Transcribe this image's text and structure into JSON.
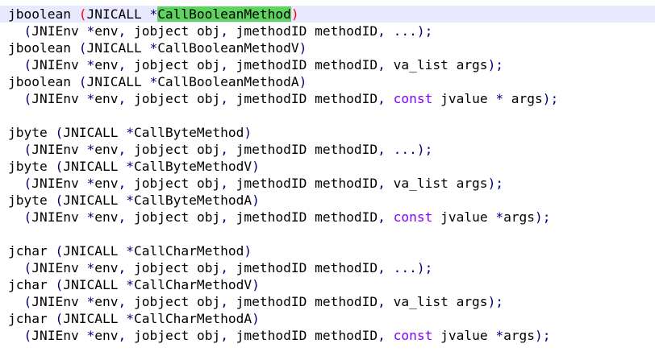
{
  "editor": {
    "lines": [
      {
        "parts": [
          {
            "t": "jboolean ",
            "c": "plain"
          },
          {
            "t": "(",
            "c": "paren-red"
          },
          {
            "t": "JNICALL ",
            "c": "plain"
          },
          {
            "t": "*",
            "c": "sym"
          },
          {
            "t": "CallBooleanMethod",
            "c": "hl"
          },
          {
            "t": ")",
            "c": "paren-red"
          }
        ]
      },
      {
        "parts": [
          {
            "t": "  ",
            "c": "plain"
          },
          {
            "t": "(",
            "c": "sym"
          },
          {
            "t": "JNIEnv ",
            "c": "plain"
          },
          {
            "t": "*",
            "c": "sym"
          },
          {
            "t": "env",
            "c": "plain"
          },
          {
            "t": ",",
            "c": "sym"
          },
          {
            "t": " jobject obj",
            "c": "plain"
          },
          {
            "t": ",",
            "c": "sym"
          },
          {
            "t": " jmethodID methodID",
            "c": "plain"
          },
          {
            "t": ",",
            "c": "sym"
          },
          {
            "t": " ",
            "c": "plain"
          },
          {
            "t": "...);",
            "c": "sym"
          }
        ]
      },
      {
        "parts": [
          {
            "t": "jboolean ",
            "c": "plain"
          },
          {
            "t": "(",
            "c": "sym"
          },
          {
            "t": "JNICALL ",
            "c": "plain"
          },
          {
            "t": "*",
            "c": "sym"
          },
          {
            "t": "CallBooleanMethodV",
            "c": "plain"
          },
          {
            "t": ")",
            "c": "sym"
          }
        ]
      },
      {
        "parts": [
          {
            "t": "  ",
            "c": "plain"
          },
          {
            "t": "(",
            "c": "sym"
          },
          {
            "t": "JNIEnv ",
            "c": "plain"
          },
          {
            "t": "*",
            "c": "sym"
          },
          {
            "t": "env",
            "c": "plain"
          },
          {
            "t": ",",
            "c": "sym"
          },
          {
            "t": " jobject obj",
            "c": "plain"
          },
          {
            "t": ",",
            "c": "sym"
          },
          {
            "t": " jmethodID methodID",
            "c": "plain"
          },
          {
            "t": ",",
            "c": "sym"
          },
          {
            "t": " va_list args",
            "c": "plain"
          },
          {
            "t": ");",
            "c": "sym"
          }
        ]
      },
      {
        "parts": [
          {
            "t": "jboolean ",
            "c": "plain"
          },
          {
            "t": "(",
            "c": "sym"
          },
          {
            "t": "JNICALL ",
            "c": "plain"
          },
          {
            "t": "*",
            "c": "sym"
          },
          {
            "t": "CallBooleanMethodA",
            "c": "plain"
          },
          {
            "t": ")",
            "c": "sym"
          }
        ]
      },
      {
        "parts": [
          {
            "t": "  ",
            "c": "plain"
          },
          {
            "t": "(",
            "c": "sym"
          },
          {
            "t": "JNIEnv ",
            "c": "plain"
          },
          {
            "t": "*",
            "c": "sym"
          },
          {
            "t": "env",
            "c": "plain"
          },
          {
            "t": ",",
            "c": "sym"
          },
          {
            "t": " jobject obj",
            "c": "plain"
          },
          {
            "t": ",",
            "c": "sym"
          },
          {
            "t": " jmethodID methodID",
            "c": "plain"
          },
          {
            "t": ",",
            "c": "sym"
          },
          {
            "t": " ",
            "c": "plain"
          },
          {
            "t": "const",
            "c": "kw"
          },
          {
            "t": " jvalue ",
            "c": "plain"
          },
          {
            "t": "*",
            "c": "sym"
          },
          {
            "t": " args",
            "c": "plain"
          },
          {
            "t": ");",
            "c": "sym"
          }
        ]
      },
      {
        "parts": []
      },
      {
        "parts": [
          {
            "t": "jbyte ",
            "c": "plain"
          },
          {
            "t": "(",
            "c": "sym"
          },
          {
            "t": "JNICALL ",
            "c": "plain"
          },
          {
            "t": "*",
            "c": "sym"
          },
          {
            "t": "CallByteMethod",
            "c": "plain"
          },
          {
            "t": ")",
            "c": "sym"
          }
        ]
      },
      {
        "parts": [
          {
            "t": "  ",
            "c": "plain"
          },
          {
            "t": "(",
            "c": "sym"
          },
          {
            "t": "JNIEnv ",
            "c": "plain"
          },
          {
            "t": "*",
            "c": "sym"
          },
          {
            "t": "env",
            "c": "plain"
          },
          {
            "t": ",",
            "c": "sym"
          },
          {
            "t": " jobject obj",
            "c": "plain"
          },
          {
            "t": ",",
            "c": "sym"
          },
          {
            "t": " jmethodID methodID",
            "c": "plain"
          },
          {
            "t": ",",
            "c": "sym"
          },
          {
            "t": " ",
            "c": "plain"
          },
          {
            "t": "...);",
            "c": "sym"
          }
        ]
      },
      {
        "parts": [
          {
            "t": "jbyte ",
            "c": "plain"
          },
          {
            "t": "(",
            "c": "sym"
          },
          {
            "t": "JNICALL ",
            "c": "plain"
          },
          {
            "t": "*",
            "c": "sym"
          },
          {
            "t": "CallByteMethodV",
            "c": "plain"
          },
          {
            "t": ")",
            "c": "sym"
          }
        ]
      },
      {
        "parts": [
          {
            "t": "  ",
            "c": "plain"
          },
          {
            "t": "(",
            "c": "sym"
          },
          {
            "t": "JNIEnv ",
            "c": "plain"
          },
          {
            "t": "*",
            "c": "sym"
          },
          {
            "t": "env",
            "c": "plain"
          },
          {
            "t": ",",
            "c": "sym"
          },
          {
            "t": " jobject obj",
            "c": "plain"
          },
          {
            "t": ",",
            "c": "sym"
          },
          {
            "t": " jmethodID methodID",
            "c": "plain"
          },
          {
            "t": ",",
            "c": "sym"
          },
          {
            "t": " va_list args",
            "c": "plain"
          },
          {
            "t": ");",
            "c": "sym"
          }
        ]
      },
      {
        "parts": [
          {
            "t": "jbyte ",
            "c": "plain"
          },
          {
            "t": "(",
            "c": "sym"
          },
          {
            "t": "JNICALL ",
            "c": "plain"
          },
          {
            "t": "*",
            "c": "sym"
          },
          {
            "t": "CallByteMethodA",
            "c": "plain"
          },
          {
            "t": ")",
            "c": "sym"
          }
        ]
      },
      {
        "parts": [
          {
            "t": "  ",
            "c": "plain"
          },
          {
            "t": "(",
            "c": "sym"
          },
          {
            "t": "JNIEnv ",
            "c": "plain"
          },
          {
            "t": "*",
            "c": "sym"
          },
          {
            "t": "env",
            "c": "plain"
          },
          {
            "t": ",",
            "c": "sym"
          },
          {
            "t": " jobject obj",
            "c": "plain"
          },
          {
            "t": ",",
            "c": "sym"
          },
          {
            "t": " jmethodID methodID",
            "c": "plain"
          },
          {
            "t": ",",
            "c": "sym"
          },
          {
            "t": " ",
            "c": "plain"
          },
          {
            "t": "const",
            "c": "kw"
          },
          {
            "t": " jvalue ",
            "c": "plain"
          },
          {
            "t": "*",
            "c": "sym"
          },
          {
            "t": "args",
            "c": "plain"
          },
          {
            "t": ");",
            "c": "sym"
          }
        ]
      },
      {
        "parts": []
      },
      {
        "parts": [
          {
            "t": "jchar ",
            "c": "plain"
          },
          {
            "t": "(",
            "c": "sym"
          },
          {
            "t": "JNICALL ",
            "c": "plain"
          },
          {
            "t": "*",
            "c": "sym"
          },
          {
            "t": "CallCharMethod",
            "c": "plain"
          },
          {
            "t": ")",
            "c": "sym"
          }
        ]
      },
      {
        "parts": [
          {
            "t": "  ",
            "c": "plain"
          },
          {
            "t": "(",
            "c": "sym"
          },
          {
            "t": "JNIEnv ",
            "c": "plain"
          },
          {
            "t": "*",
            "c": "sym"
          },
          {
            "t": "env",
            "c": "plain"
          },
          {
            "t": ",",
            "c": "sym"
          },
          {
            "t": " jobject obj",
            "c": "plain"
          },
          {
            "t": ",",
            "c": "sym"
          },
          {
            "t": " jmethodID methodID",
            "c": "plain"
          },
          {
            "t": ",",
            "c": "sym"
          },
          {
            "t": " ",
            "c": "plain"
          },
          {
            "t": "...);",
            "c": "sym"
          }
        ]
      },
      {
        "parts": [
          {
            "t": "jchar ",
            "c": "plain"
          },
          {
            "t": "(",
            "c": "sym"
          },
          {
            "t": "JNICALL ",
            "c": "plain"
          },
          {
            "t": "*",
            "c": "sym"
          },
          {
            "t": "CallCharMethodV",
            "c": "plain"
          },
          {
            "t": ")",
            "c": "sym"
          }
        ]
      },
      {
        "parts": [
          {
            "t": "  ",
            "c": "plain"
          },
          {
            "t": "(",
            "c": "sym"
          },
          {
            "t": "JNIEnv ",
            "c": "plain"
          },
          {
            "t": "*",
            "c": "sym"
          },
          {
            "t": "env",
            "c": "plain"
          },
          {
            "t": ",",
            "c": "sym"
          },
          {
            "t": " jobject obj",
            "c": "plain"
          },
          {
            "t": ",",
            "c": "sym"
          },
          {
            "t": " jmethodID methodID",
            "c": "plain"
          },
          {
            "t": ",",
            "c": "sym"
          },
          {
            "t": " va_list args",
            "c": "plain"
          },
          {
            "t": ");",
            "c": "sym"
          }
        ]
      },
      {
        "parts": [
          {
            "t": "jchar ",
            "c": "plain"
          },
          {
            "t": "(",
            "c": "sym"
          },
          {
            "t": "JNICALL ",
            "c": "plain"
          },
          {
            "t": "*",
            "c": "sym"
          },
          {
            "t": "CallCharMethodA",
            "c": "plain"
          },
          {
            "t": ")",
            "c": "sym"
          }
        ]
      },
      {
        "parts": [
          {
            "t": "  ",
            "c": "plain"
          },
          {
            "t": "(",
            "c": "sym"
          },
          {
            "t": "JNIEnv ",
            "c": "plain"
          },
          {
            "t": "*",
            "c": "sym"
          },
          {
            "t": "env",
            "c": "plain"
          },
          {
            "t": ",",
            "c": "sym"
          },
          {
            "t": " jobject obj",
            "c": "plain"
          },
          {
            "t": ",",
            "c": "sym"
          },
          {
            "t": " jmethodID methodID",
            "c": "plain"
          },
          {
            "t": ",",
            "c": "sym"
          },
          {
            "t": " ",
            "c": "plain"
          },
          {
            "t": "const",
            "c": "kw"
          },
          {
            "t": " jvalue ",
            "c": "plain"
          },
          {
            "t": "*",
            "c": "sym"
          },
          {
            "t": "args",
            "c": "plain"
          },
          {
            "t": ");",
            "c": "sym"
          }
        ]
      }
    ]
  },
  "colors": {
    "background": "#ffffff",
    "current_line": "#e8e8ff",
    "operator": "#000080",
    "keyword": "#8000ff",
    "brace_match": "#ff0000",
    "selection_highlight": "#5fd35f"
  }
}
